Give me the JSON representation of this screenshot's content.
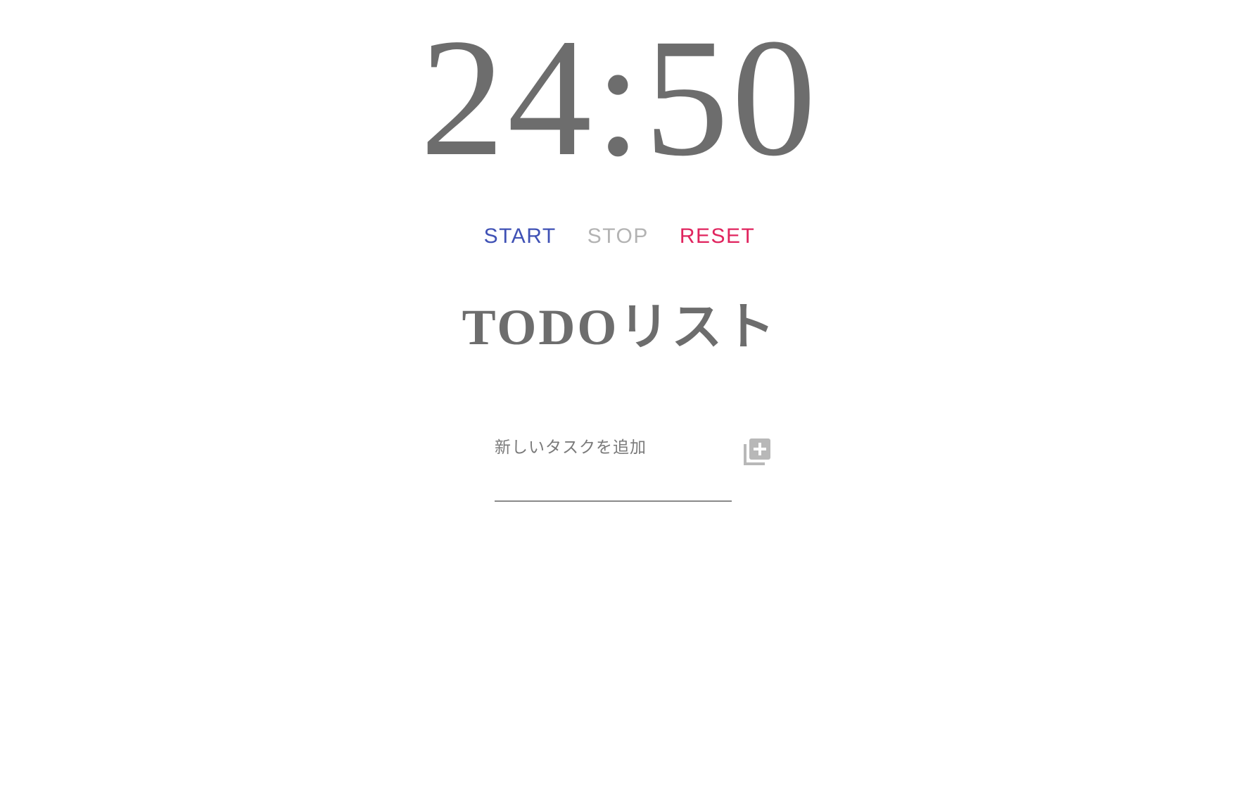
{
  "timer": {
    "display": "24:50"
  },
  "controls": {
    "start_label": "START",
    "stop_label": "STOP",
    "reset_label": "RESET",
    "colors": {
      "start": "#3f51b5",
      "stop": "#b3b3b3",
      "reset": "#e0245e"
    }
  },
  "todo": {
    "title": "TODOリスト",
    "new_task": {
      "placeholder": "新しいタスクを追加",
      "value": "",
      "add_icon": "add-to-list-icon"
    },
    "items": []
  }
}
